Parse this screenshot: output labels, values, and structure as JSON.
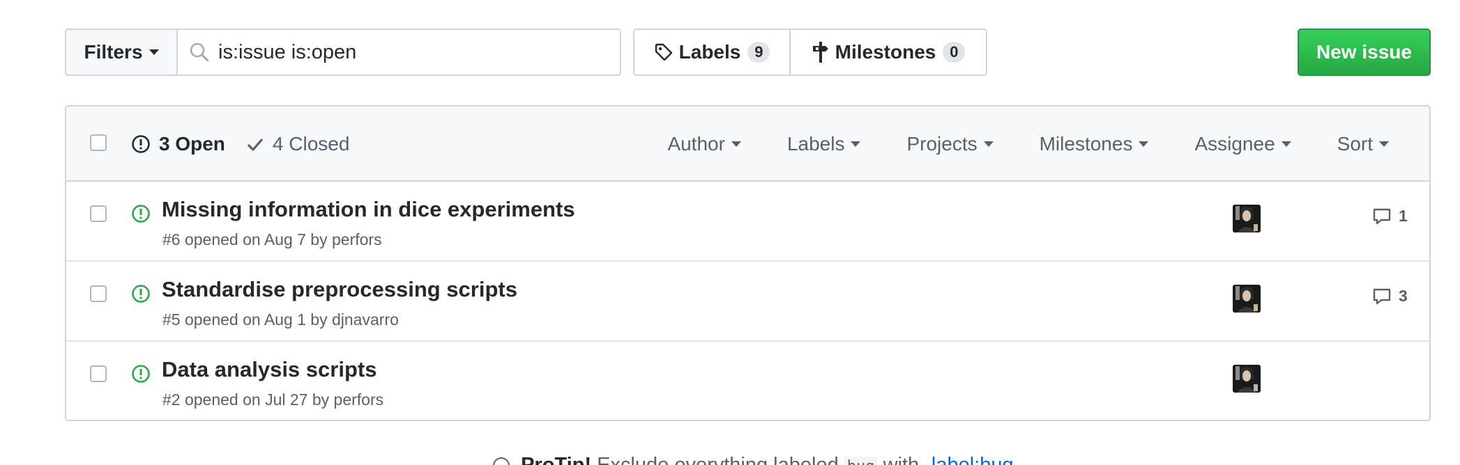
{
  "toolbar": {
    "filters_label": "Filters",
    "search_value": "is:issue is:open",
    "labels_label": "Labels",
    "labels_count": "9",
    "milestones_label": "Milestones",
    "milestones_count": "0",
    "new_issue_label": "New issue"
  },
  "header": {
    "open_label": "3 Open",
    "closed_label": "4 Closed",
    "filters": [
      "Author",
      "Labels",
      "Projects",
      "Milestones",
      "Assignee",
      "Sort"
    ]
  },
  "issues": [
    {
      "title": "Missing information in dice experiments",
      "meta": "#6 opened on Aug 7 by perfors",
      "comments": "1"
    },
    {
      "title": "Standardise preprocessing scripts",
      "meta": "#5 opened on Aug 1 by djnavarro",
      "comments": "3"
    },
    {
      "title": "Data analysis scripts",
      "meta": "#2 opened on Jul 27 by perfors",
      "comments": ""
    }
  ],
  "protip": {
    "heading": "ProTip!",
    "text": "Exclude everything labeled",
    "code": "bug",
    "with": "with",
    "link": "-label:bug"
  },
  "colors": {
    "open_green": "#28a745",
    "link_blue": "#0366d6",
    "muted_gray": "#586069",
    "border_gray": "#d1d5da"
  },
  "icons": {
    "search": "search-icon",
    "labels": "tag-icon",
    "milestones": "milestone-icon",
    "open": "issue-opened-icon",
    "closed": "check-icon",
    "comment": "comment-icon"
  }
}
